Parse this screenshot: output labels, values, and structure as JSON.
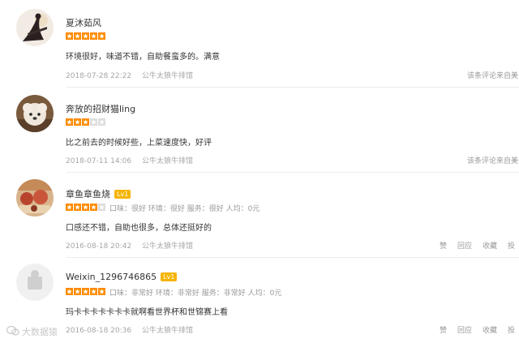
{
  "reviews": [
    {
      "user": "夏沐茹风",
      "stars": 5,
      "content": "环境很好，味道不错，自助餐蛮多的。满意",
      "date": "2018-07-28 22:22",
      "shop": "公牛太狼牛排馆",
      "right_link": "该条评论来自美"
    },
    {
      "user": "奔放的招财猫ling",
      "stars": 3,
      "content": "比之前去的时候好些，上菜速度快，好评",
      "date": "2018-07-11 14:06",
      "shop": "公牛太狼牛排馆",
      "right_link": "该条评论来自美"
    },
    {
      "user": "章鱼章鱼烧",
      "level_badge": "Lv1",
      "stars": 4,
      "scores": "口味：很好   环境：很好   服务：很好   人均：0元",
      "content": "口感还不错，自助也很多，总体还挺好的",
      "date": "2016-08-18 20:42",
      "shop": "公牛太狼牛排馆",
      "actions": [
        "赞",
        "回应",
        "收藏",
        "投"
      ]
    },
    {
      "user": "Weixin_1296746865",
      "level_badge": "Lv1",
      "stars": 5,
      "scores": "口味：非常好   环境：非常好   服务：非常好   人均：0元",
      "content": "玛卡卡卡卡卡卡卡就啊看世界杯和世锦赛上看",
      "date": "2016-08-18 20:36",
      "shop": "公牛太狼牛排馆",
      "actions": [
        "赞",
        "回应",
        "收藏",
        "投"
      ]
    }
  ],
  "watermark": "大数据猿",
  "colors": {
    "star_on": "#ff8b00",
    "star_off": "#dddddd",
    "badge": "#f5b400"
  }
}
